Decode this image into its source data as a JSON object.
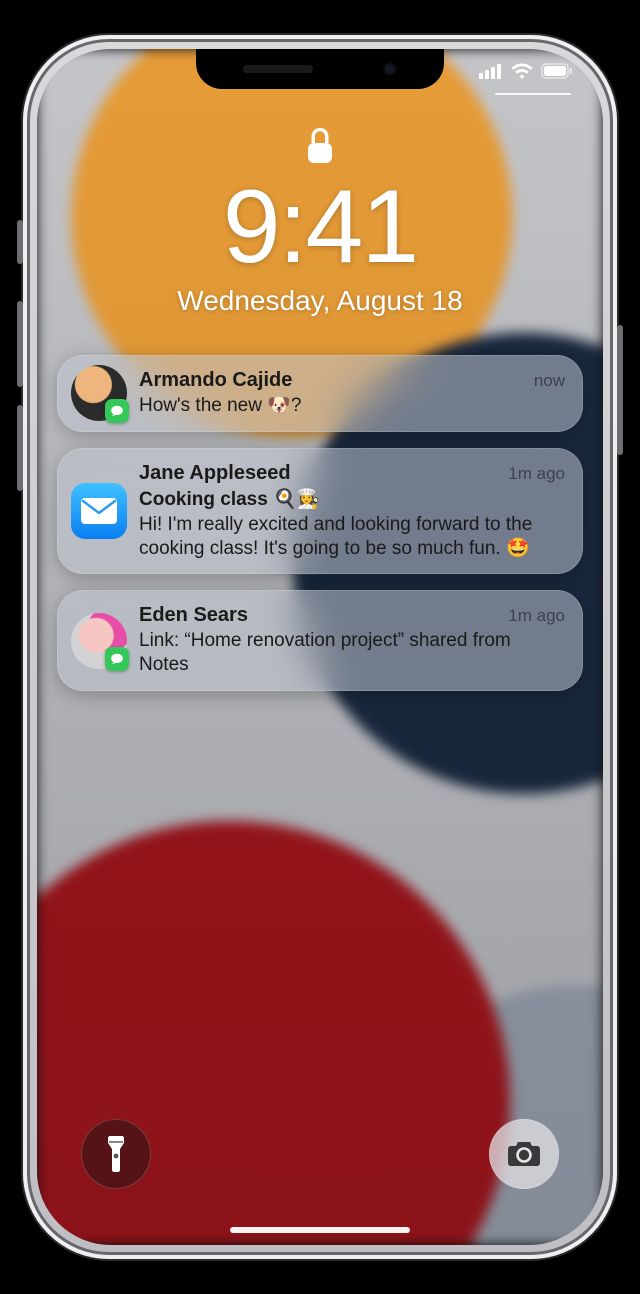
{
  "status": {
    "cellular_bars": 4,
    "wifi_bars": 3,
    "battery_pct": 100
  },
  "lock": {
    "time": "9:41",
    "date": "Wednesday, August 18"
  },
  "notifications": [
    {
      "sender": "Armando Cajide",
      "time": "now",
      "body": "How's the new 🐶?",
      "app": "messages"
    },
    {
      "sender": "Jane Appleseed",
      "time": "1m ago",
      "subject": "Cooking class 🍳👩‍🍳",
      "body": "Hi! I'm really excited and looking forward to the cooking class! It's going to be so much fun. 🤩",
      "app": "mail"
    },
    {
      "sender": "Eden Sears",
      "time": "1m ago",
      "body": "Link: “Home renovation project” shared from Notes",
      "app": "messages"
    }
  ],
  "icons": {
    "lock": "lock-icon",
    "flashlight": "flashlight-icon",
    "camera": "camera-icon",
    "cellular": "cellular-icon",
    "wifi": "wifi-icon",
    "battery": "battery-icon",
    "messages": "messages-app-icon",
    "mail": "mail-app-icon"
  }
}
